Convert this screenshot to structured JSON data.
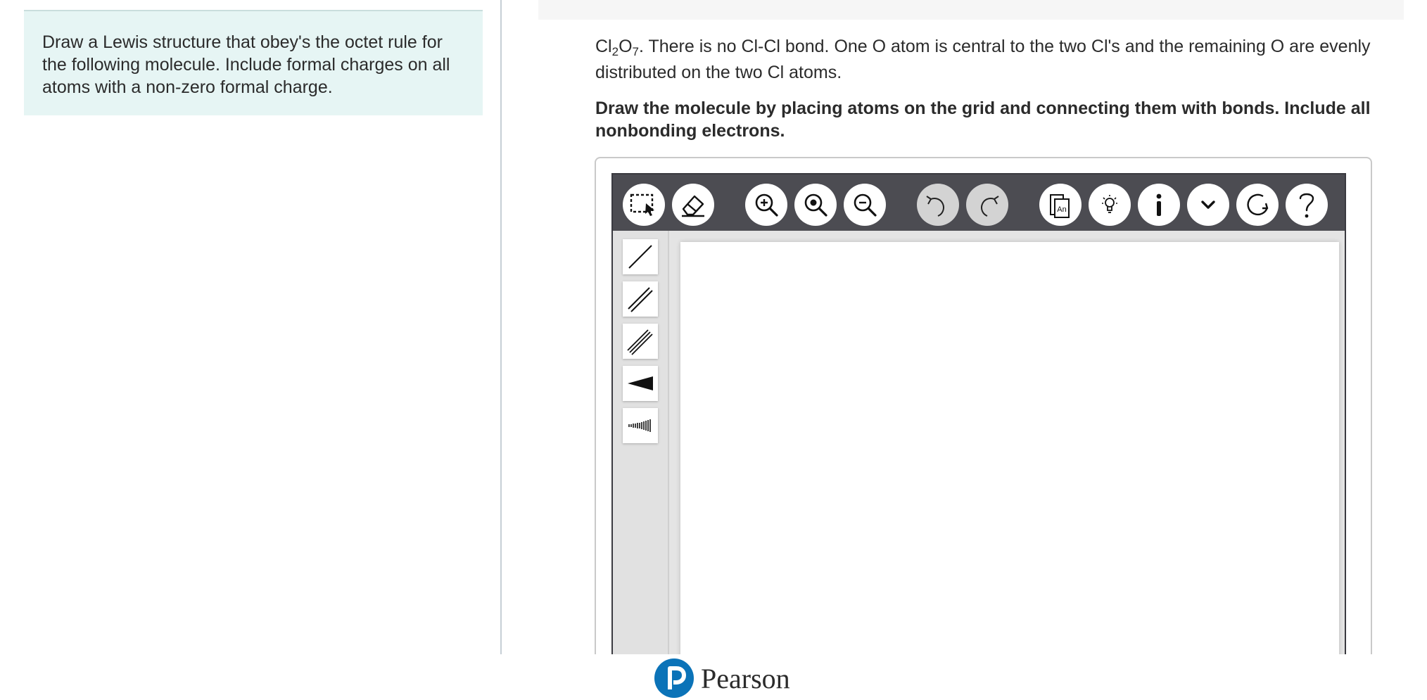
{
  "instructions": "Draw a Lewis structure that obey's the octet rule for the following molecule. Include formal charges on all atoms with a non-zero formal charge.",
  "question": {
    "formula_el1": "Cl",
    "formula_sub1": "2",
    "formula_el2": "O",
    "formula_sub2": "7",
    "text": ".  There is no Cl-Cl bond. One O atom is central to the two Cl's and the remaining O are evenly distributed on the two Cl atoms."
  },
  "directive": "Draw the molecule by placing atoms on the grid and connecting them with bonds. Include all nonbonding electrons.",
  "toolbar": {
    "buttons": [
      {
        "name": "select-tool-button",
        "icon": "select-icon"
      },
      {
        "name": "eraser-tool-button",
        "icon": "eraser-icon"
      },
      {
        "name": "zoom-in-button",
        "icon": "zoom-in-icon"
      },
      {
        "name": "zoom-reset-button",
        "icon": "zoom-reset-icon"
      },
      {
        "name": "zoom-out-button",
        "icon": "zoom-out-icon"
      },
      {
        "name": "undo-button",
        "icon": "undo-icon"
      },
      {
        "name": "redo-button",
        "icon": "redo-icon"
      },
      {
        "name": "templates-button",
        "icon": "templates-icon"
      },
      {
        "name": "hint-button",
        "icon": "lightbulb-icon"
      },
      {
        "name": "info-button",
        "icon": "info-icon"
      },
      {
        "name": "more-button",
        "icon": "chevron-down-icon"
      },
      {
        "name": "reset-button",
        "icon": "reset-icon"
      },
      {
        "name": "help-button",
        "icon": "question-icon"
      }
    ],
    "templates_label": "An"
  },
  "bond_tools": [
    {
      "name": "single-bond-button",
      "icon": "single-bond-icon"
    },
    {
      "name": "double-bond-button",
      "icon": "double-bond-icon"
    },
    {
      "name": "triple-bond-button",
      "icon": "triple-bond-icon"
    },
    {
      "name": "wedge-bond-button",
      "icon": "wedge-bond-icon"
    },
    {
      "name": "hash-bond-button",
      "icon": "hash-bond-icon"
    }
  ],
  "footer": {
    "brand": "Pearson"
  },
  "colors": {
    "instruction_bg": "#e6f5f4",
    "toolbar_bg": "#4c4c52",
    "pearson_blue": "#0b73b8"
  }
}
